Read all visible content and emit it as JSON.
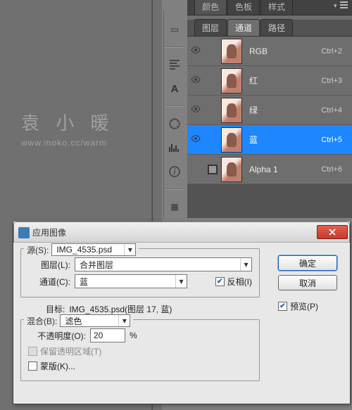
{
  "watermark": {
    "main": "袁 小 暖",
    "url": "www.moko.cc/warm"
  },
  "top_panel": {
    "tabs": [
      "颜色",
      "色板",
      "样式"
    ],
    "active_tab": 0
  },
  "layer_panel": {
    "tabs": [
      "图层",
      "通道",
      "路径"
    ],
    "active_tab": 1,
    "channels": [
      {
        "name": "RGB",
        "shortcut": "Ctrl+2",
        "visible": true,
        "checkbox": false
      },
      {
        "name": "红",
        "shortcut": "Ctrl+3",
        "visible": true,
        "checkbox": false
      },
      {
        "name": "绿",
        "shortcut": "Ctrl+4",
        "visible": true,
        "checkbox": false
      },
      {
        "name": "蓝",
        "shortcut": "Ctrl+5",
        "visible": true,
        "checkbox": false,
        "selected": true
      },
      {
        "name": "Alpha 1",
        "shortcut": "Ctrl+6",
        "visible": false,
        "checkbox": true
      }
    ]
  },
  "dialog": {
    "title": "应用图像",
    "source": {
      "label": "源(S):",
      "value": "IMG_4535.psd",
      "layer_label": "图层(L):",
      "layer_value": "合并图层",
      "channel_label": "通道(C):",
      "channel_value": "蓝",
      "invert_label": "反相(I)",
      "invert_checked": true
    },
    "target": {
      "label": "目标:",
      "value": "IMG_4535.psd(图层 17, 蓝)"
    },
    "blend": {
      "label": "混合(B):",
      "value": "滤色",
      "opacity_label": "不透明度(O):",
      "opacity_value": "20",
      "opacity_unit": "%",
      "preserve_label": "保留透明区域(T)",
      "preserve_checked": false,
      "preserve_disabled": true,
      "mask_label": "蒙版(K)...",
      "mask_checked": false
    },
    "buttons": {
      "ok": "确定",
      "cancel": "取消"
    },
    "preview": {
      "label": "预览(P)",
      "checked": true
    }
  }
}
